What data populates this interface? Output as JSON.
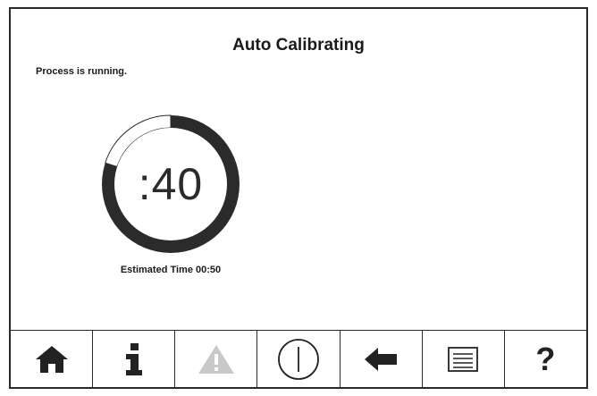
{
  "header": {
    "title": "Auto Calibrating",
    "status": "Process is running."
  },
  "timer": {
    "remaining": ":40",
    "estimated_time": "Estimated Time 00:50",
    "progress_fraction": 0.2
  },
  "toolbar": {
    "buttons": [
      {
        "icon": "home-icon"
      },
      {
        "icon": "info-icon"
      },
      {
        "icon": "warning-icon",
        "state": "disabled"
      },
      {
        "icon": "power-icon"
      },
      {
        "icon": "back-arrow-icon"
      },
      {
        "icon": "list-icon"
      },
      {
        "icon": "help-icon",
        "glyph": "?"
      }
    ]
  },
  "colors": {
    "ring": "#2b2b2b",
    "ring_track": "#ffffff",
    "icon": "#222222",
    "icon_disabled": "#c8c8c8"
  }
}
